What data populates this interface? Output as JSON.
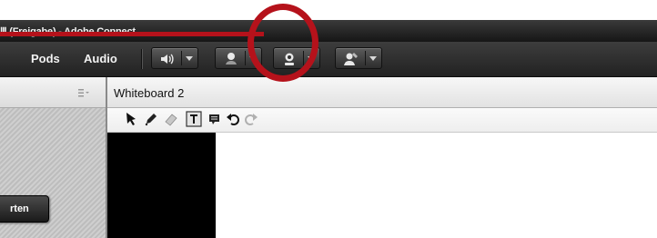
{
  "window": {
    "title": "Ⅲ (Freigabe) - Adobe Connect"
  },
  "menubar": {
    "pods": "Pods",
    "audio": "Audio"
  },
  "toolbar": {
    "buttons": [
      {
        "icon": "speaker-icon"
      },
      {
        "icon": "microphone-icon"
      },
      {
        "icon": "webcam-icon"
      },
      {
        "icon": "raise-hand-icon"
      }
    ]
  },
  "left_pod": {
    "button_label": "rten"
  },
  "whiteboard": {
    "title": "Whiteboard 2",
    "tools": [
      "pointer-tool-icon",
      "pencil-tool-icon",
      "eraser-tool-icon",
      "text-tool-icon",
      "shape-tool-icon",
      "undo-icon",
      "redo-icon"
    ]
  },
  "annotation": {
    "color": "#b5121b"
  },
  "colors": {
    "toolbar": "#2a2a2a",
    "annotation": "#b5121b"
  }
}
